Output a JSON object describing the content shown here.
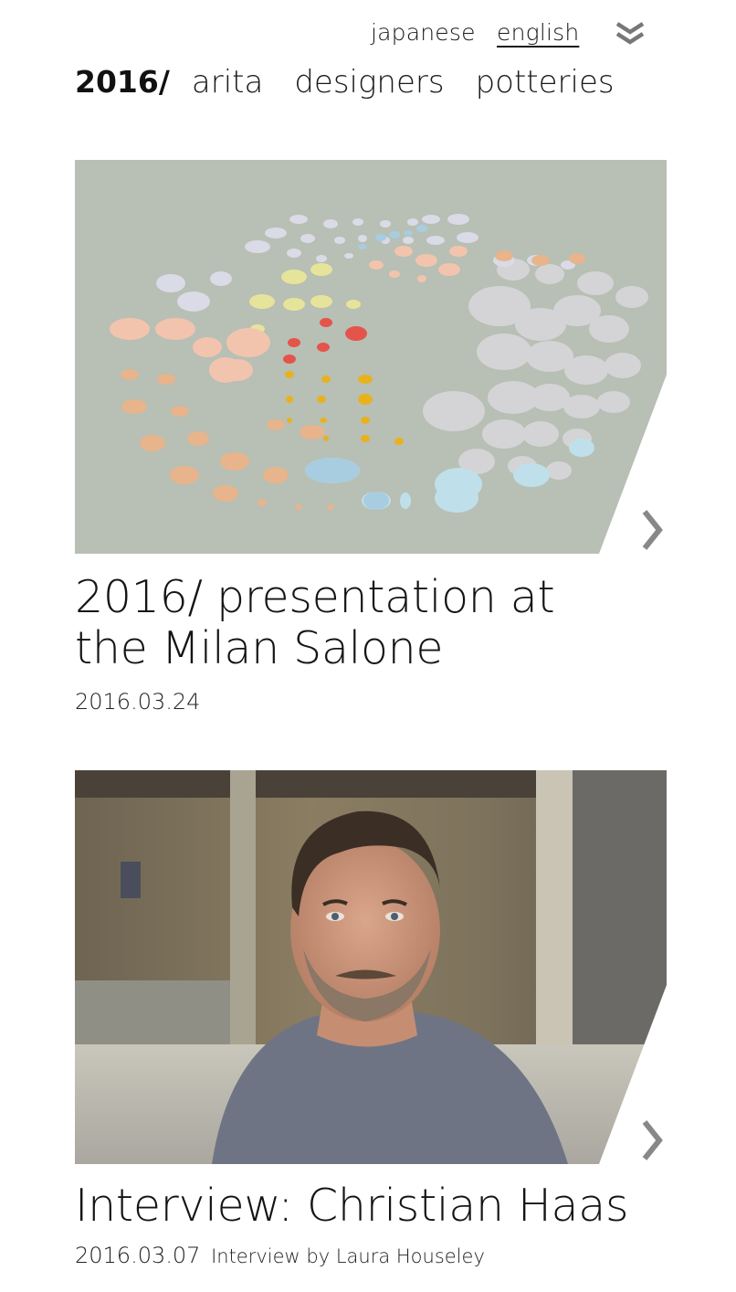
{
  "header": {
    "lang_japanese": "japanese",
    "lang_english": "english",
    "menu_icon": "double-chevron-down-icon"
  },
  "nav": {
    "year": "2016/",
    "items": [
      "arita",
      "designers",
      "potteries"
    ]
  },
  "articles": [
    {
      "title": "2016/ presentation at the Milan Salone",
      "date": "2016.03.24",
      "byline": "",
      "image": "dotted-color-chart-photo"
    },
    {
      "title": "Interview: Christian Haas",
      "date": "2016.03.07",
      "byline": "Interview by Laura Houseley",
      "image": "portrait-photo"
    }
  ],
  "colors": {
    "text": "#1a1a1a",
    "arrow": "#8a8a8a",
    "photo1_bg": "#b9bfb5"
  }
}
